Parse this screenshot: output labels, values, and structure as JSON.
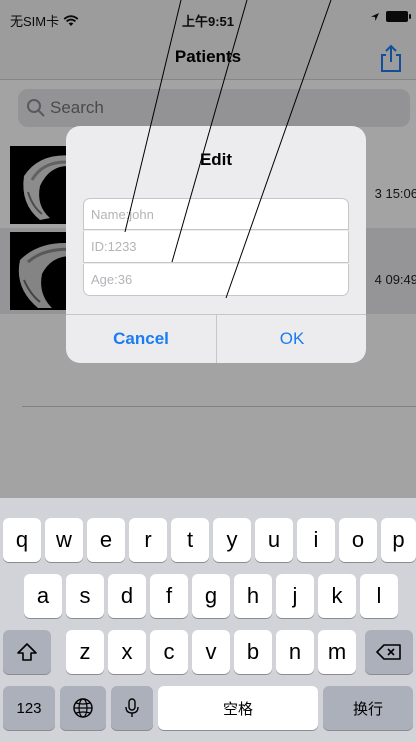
{
  "status_bar": {
    "carrier": "无SIM卡",
    "time": "上午9:51"
  },
  "nav": {
    "title": "Patients"
  },
  "search": {
    "placeholder": "Search"
  },
  "patients": [
    {
      "date": "3 15:06"
    },
    {
      "date": "4 09:49"
    }
  ],
  "dialog": {
    "title": "Edit",
    "fields": [
      {
        "value": "Name:john"
      },
      {
        "value": "ID:1233"
      },
      {
        "value": "Age:36"
      }
    ],
    "cancel_label": "Cancel",
    "ok_label": "OK"
  },
  "keyboard": {
    "row1": [
      "q",
      "w",
      "e",
      "r",
      "t",
      "y",
      "u",
      "i",
      "o",
      "p"
    ],
    "row2": [
      "a",
      "s",
      "d",
      "f",
      "g",
      "h",
      "j",
      "k",
      "l"
    ],
    "row3": [
      "z",
      "x",
      "c",
      "v",
      "b",
      "n",
      "m"
    ],
    "numbers_label": "123",
    "space_label": "空格",
    "return_label": "换行"
  },
  "colors": {
    "accent": "#1b7cf2",
    "bar_bg": "#f4f4f6",
    "keyboard_bg": "#d1d3d9"
  },
  "icons": [
    "wifi-icon",
    "location-icon",
    "battery-icon",
    "share-icon",
    "search-icon",
    "shift-icon",
    "delete-icon",
    "globe-icon",
    "microphone-icon"
  ]
}
